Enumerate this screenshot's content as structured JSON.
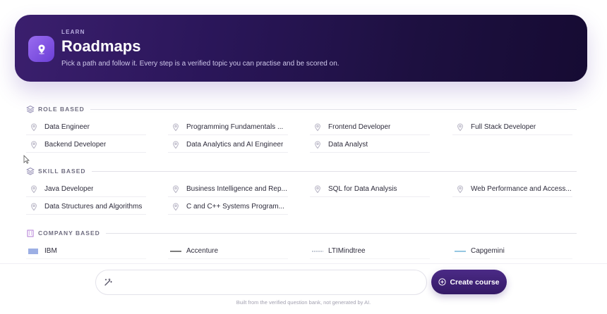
{
  "hero": {
    "eyebrow": "LEARN",
    "title": "Roadmaps",
    "subtitle": "Pick a path and follow it. Every step is a verified topic you can practise and be scored on.",
    "icon": "map-pin-icon"
  },
  "sections": [
    {
      "title": "ROLE BASED",
      "icon": "layers-icon",
      "items": [
        "Data Engineer",
        "Programming Fundamentals ...",
        "Frontend Developer",
        "Full Stack Developer",
        "Backend Developer",
        "Data Analytics and AI Engineer",
        "Data Analyst"
      ]
    },
    {
      "title": "SKILL BASED",
      "icon": "layers-icon",
      "items": [
        "Java Developer",
        "Business Intelligence and Rep...",
        "SQL for Data Analysis",
        "Web Performance and Access...",
        "Data Structures and Algorithms",
        "C and C++ Systems Program..."
      ]
    },
    {
      "title": "COMPANY BASED",
      "icon": "building-icon",
      "items": [
        "IBM",
        "Accenture",
        "LTIMindtree",
        "Capgemini"
      ]
    }
  ],
  "composer": {
    "input_value": "",
    "input_placeholder": "",
    "create_label": "Create course",
    "footnote": "Built from the verified question bank, not generated by AI."
  },
  "colors": {
    "hero_start": "#3b1f6e",
    "hero_end": "#160b33",
    "accent": "#6b3fd6",
    "button": "#3e2275"
  }
}
